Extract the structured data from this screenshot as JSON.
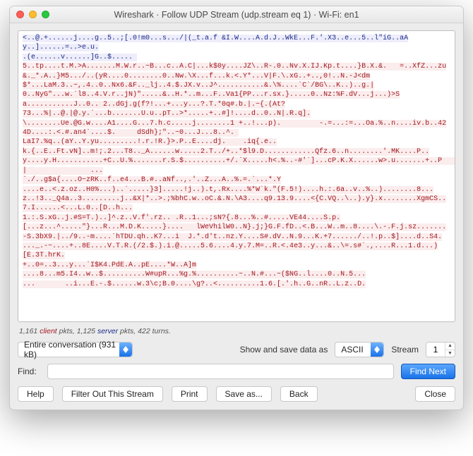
{
  "window": {
    "title": "Wireshark · Follow UDP Stream (udp.stream eq 1) · Wi-Fi: en1"
  },
  "stream": {
    "segments": [
      {
        "dir": "server",
        "text": "<..@.+......j....g..5..;[.0!m0...s.../|(_t.a.f &I.W....A.d.J..WkE...F.'.X3..e...5..l\"iG..aAy..]......=..>e.u."
      },
      {
        "dir": "server",
        "text": "\n.(e......v......]G..$..... "
      },
      {
        "dir": "client",
        "text": "\n5..tp....t.M.>A.......M.W.r..~B...c..A.C|...k$0y....JZ\\..R-.0..Nv.X.IJ.Kp.t....}B.X.&.   =..XfZ...zu&._*.A..}M5.../..(yR....0........0..Nw.\\X...f...k.<.Y*...V|F.\\.xG..+..,0!..N.-J<dm"
      },
      {
        "dir": "client",
        "text": "\n$*...LaM.3..~,.4..0..Nx6.&F.._lj..4.$.JX.v..J^...........&.\\%...­.`C`/BG\\..K..)..g.|"
      },
      {
        "dir": "client",
        "text": "\n0..NyG\"...w.`l8..4.V.r..jN)\".....&..H.*..m...F..Va1{PP...r.sx.}.....0..Nz:%F.dV...j...)>Sa...........J..0.. 2..dGj.g(f?!...+...y...?.T.*0q#.b.|.~{.(At?"
      },
      {
        "dir": "client",
        "text": "\n73...%|..@.|@.y.`...b.......U.u..pT..>*.....+..#]!....d..0..N|.R.q]."
      },
      {
        "dir": "client",
        "text": "\n\\........Ue.@G.w....A1....G...7.h.c.....j........1 +..!...p).         -.=...:=...Oa.%..n....iv.b..424D....:.<.#.an4`....$.     dSdh};\"..~0...J...8..^. "
      },
      {
        "dir": "client",
        "text": "\nLaI7.%q..(aY..Y.yu.........!.r.!R.}>.P..E....dj.    .iq{.e.."
      },
      {
        "dir": "client",
        "text": "\nk.{..E..Ft.vN]..m!;.2...T8.._A......w.....2.T../+..*$l9.D............Qfz.6..n........'.MK....P..y....y.H...........+C..U.%.......r.S.$..........+/.`X.....h<.%..-#'`]...cP.K.X......w>.u.......+..P        |               ..."
      },
      {
        "dir": "client",
        "text": "\n`./..g$a{....O~zRK..f..e4...B.#..aNf..,.'..Z...A..%.=.`...*.Y"
      },
      {
        "dir": "client",
        "text": "\n....e..<.z.oz..H0%...)..`.....}3].....!j..).t,.Rx....%*W`k.\"(F.5!)....h.:.6a..v..%..)........8...z..!3.._Q4a..3.........j..&X|*..>.;%bhC.w..oC.&.N.\\A3....q9.13.9....<{C.VQ..\\..).y}.x........XgmCS..7.I......<...L.0..[D..h..."
      },
      {
        "dir": "client",
        "text": "\n1.:.S.xG..j.#S=T.)..]^.z..V.f'.rz.. .R..1...;sN?{.8...%..#.....VE44....S.p."
      },
      {
        "dir": "client",
        "text": "\n[...z...^.....­\"}...R...M.D.K.....}....   lWeVhilW0..N}.j;}G.F.fD..<.B...W..m..8....\\.-.F.j.sz.......-S.3bX9.|../9..-m....`hTDU.qh..K7...i  J.*.d't..nz.Y....S#.dV..N.9...K.+7....../..!.p..$]....d..S4."
      },
      {
        "dir": "client",
        "text": "\n..._.-~....+..8E....V.T.R.­(/2.$.).i.@...­..5.6....4.y.7.M=..R.<.4e3..y...&..\\=.s#`.,....R...1.d...)[E.3T.hrK."
      },
      {
        "dir": "client",
        "text": "\n+..0=..3...y...`I$K4.PdE.A..pE....*W..A]m"
      },
      {
        "dir": "client",
        "text": "\n....8...m5.I4..w..$..........W#upR...%g.%..........~..N.#...~($NG..l...­.0..N.5..."
      },
      {
        "dir": "client",
        "text": "\n...       ..i...E.-.$......w.3\\c;B.0....\\g?..<..........1.6.[.'.h..G..nR..L.z..D."
      }
    ]
  },
  "summary": {
    "client_pkts": "1,161",
    "client_word": "client",
    "mid1": " pkts, ",
    "server_pkts": "1,125",
    "server_word": "server",
    "mid2": " pkts, ",
    "turns": "422 turns."
  },
  "controls": {
    "conversation_select": "Entire conversation (931 kB)",
    "show_as_label": "Show and save data as",
    "show_as_value": "ASCII",
    "stream_label": "Stream",
    "stream_value": "1",
    "find_label": "Find:",
    "find_value": "",
    "find_next": "Find Next"
  },
  "buttons": {
    "help": "Help",
    "filter_out": "Filter Out This Stream",
    "print": "Print",
    "save_as": "Save as...",
    "back": "Back",
    "close": "Close"
  }
}
